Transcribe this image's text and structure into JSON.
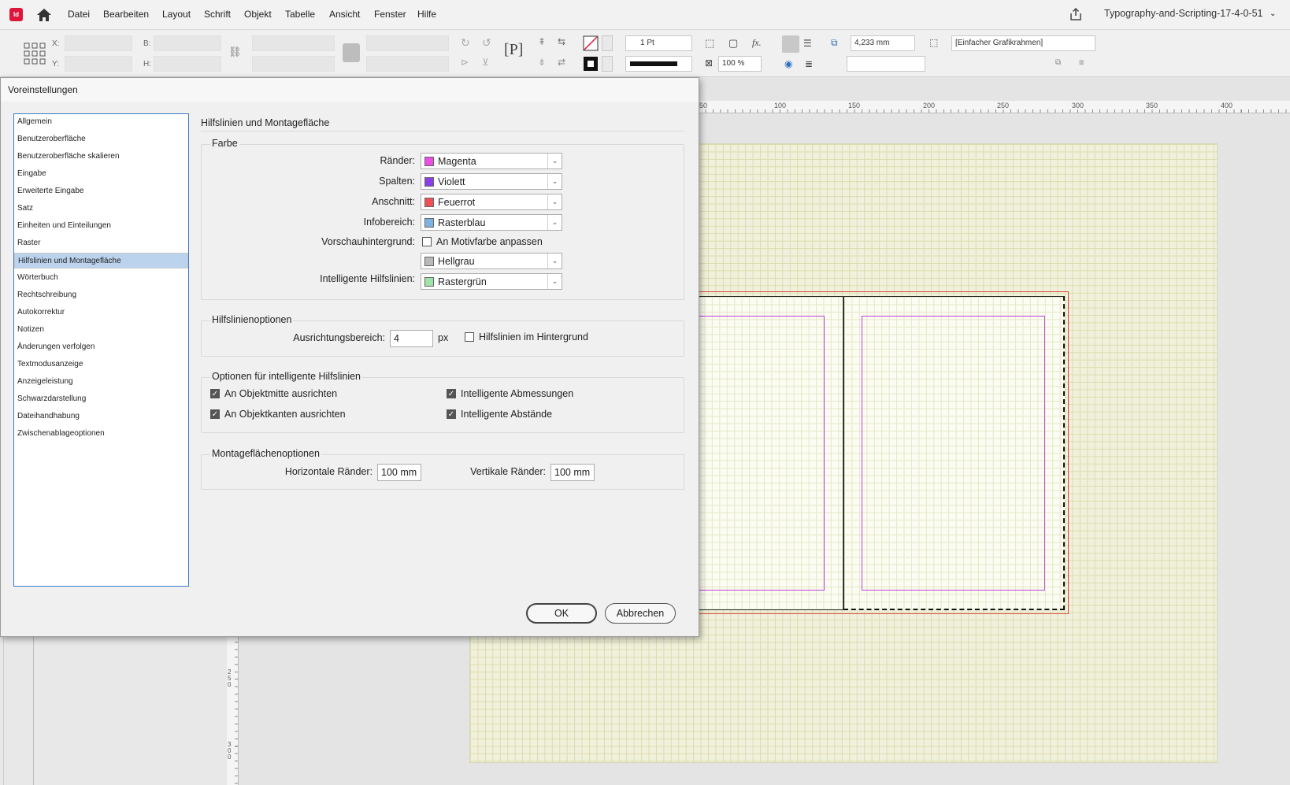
{
  "menubar": {
    "app_icon": "Id",
    "items": [
      "Datei",
      "Bearbeiten",
      "Layout",
      "Schrift",
      "Objekt",
      "Tabelle",
      "Ansicht",
      "Fenster",
      "Hilfe"
    ],
    "doc_title": "Typography-and-Scripting-17-4-0-51"
  },
  "toolbar": {
    "x_label": "X:",
    "y_label": "Y:",
    "b_label": "B:",
    "h_label": "H:",
    "stroke_weight": "1 Pt",
    "scale": "100 %",
    "gutter": "4,233 mm",
    "object_style": "[Einfacher Grafikrahmen]"
  },
  "ruler": {
    "labels": [
      "50",
      "100",
      "150",
      "200",
      "250",
      "300",
      "350",
      "400"
    ],
    "v_labels": [
      "2\n5\n0",
      "3\n0\n0"
    ]
  },
  "dialog": {
    "title": "Voreinstellungen",
    "categories": [
      "Allgemein",
      "Benutzeroberfläche",
      "Benutzeroberfläche skalieren",
      "Eingabe",
      "Erweiterte Eingabe",
      "Satz",
      "Einheiten und Einteilungen",
      "Raster",
      "Hilfslinien und Montagefläche",
      "Wörterbuch",
      "Rechtschreibung",
      "Autokorrektur",
      "Notizen",
      "Änderungen verfolgen",
      "Textmodusanzeige",
      "Anzeigeleistung",
      "Schwarzdarstellung",
      "Dateihandhabung",
      "Zwischenablageoptionen"
    ],
    "selected_category": "Hilfslinien und Montagefläche",
    "section_title": "Hilfslinien und Montagefläche",
    "farbe": {
      "group_label": "Farbe",
      "raender": {
        "label": "Ränder:",
        "value": "Magenta",
        "color": "#e94ee6"
      },
      "spalten": {
        "label": "Spalten:",
        "value": "Violett",
        "color": "#8b3fe8"
      },
      "anschnitt": {
        "label": "Anschnitt:",
        "value": "Feuerrot",
        "color": "#ef4f55"
      },
      "infobereich": {
        "label": "Infobereich:",
        "value": "Rasterblau",
        "color": "#7fb2e0"
      },
      "vorschau": {
        "label": "Vorschauhintergrund:",
        "checkbox_label": "An Motivfarbe anpassen",
        "checked": false,
        "value": "Hellgrau",
        "color": "#b9b9b9"
      },
      "intelligent": {
        "label": "Intelligente Hilfslinien:",
        "value": "Rastergrün",
        "color": "#9fe3a5"
      }
    },
    "hilfslinienoptionen": {
      "group_label": "Hilfslinienoptionen",
      "ausrichtung_label": "Ausrichtungsbereich:",
      "ausrichtung_value": "4",
      "unit": "px",
      "hintergrund_label": "Hilfslinien im Hintergrund",
      "hintergrund_checked": false
    },
    "intelligente": {
      "group_label": "Optionen für intelligente Hilfslinien",
      "mitte_label": "An Objektmitte ausrichten",
      "mitte_checked": true,
      "kanten_label": "An Objektkanten ausrichten",
      "kanten_checked": true,
      "abmessungen_label": "Intelligente Abmessungen",
      "abmessungen_checked": true,
      "abstaende_label": "Intelligente Abstände",
      "abstaende_checked": true
    },
    "montage": {
      "group_label": "Montageflächenoptionen",
      "horizontal_label": "Horizontale Ränder:",
      "horizontal_value": "100 mm",
      "vertikal_label": "Vertikale Ränder:",
      "vertikal_value": "100 mm"
    },
    "ok_label": "OK",
    "cancel_label": "Abbrechen"
  }
}
